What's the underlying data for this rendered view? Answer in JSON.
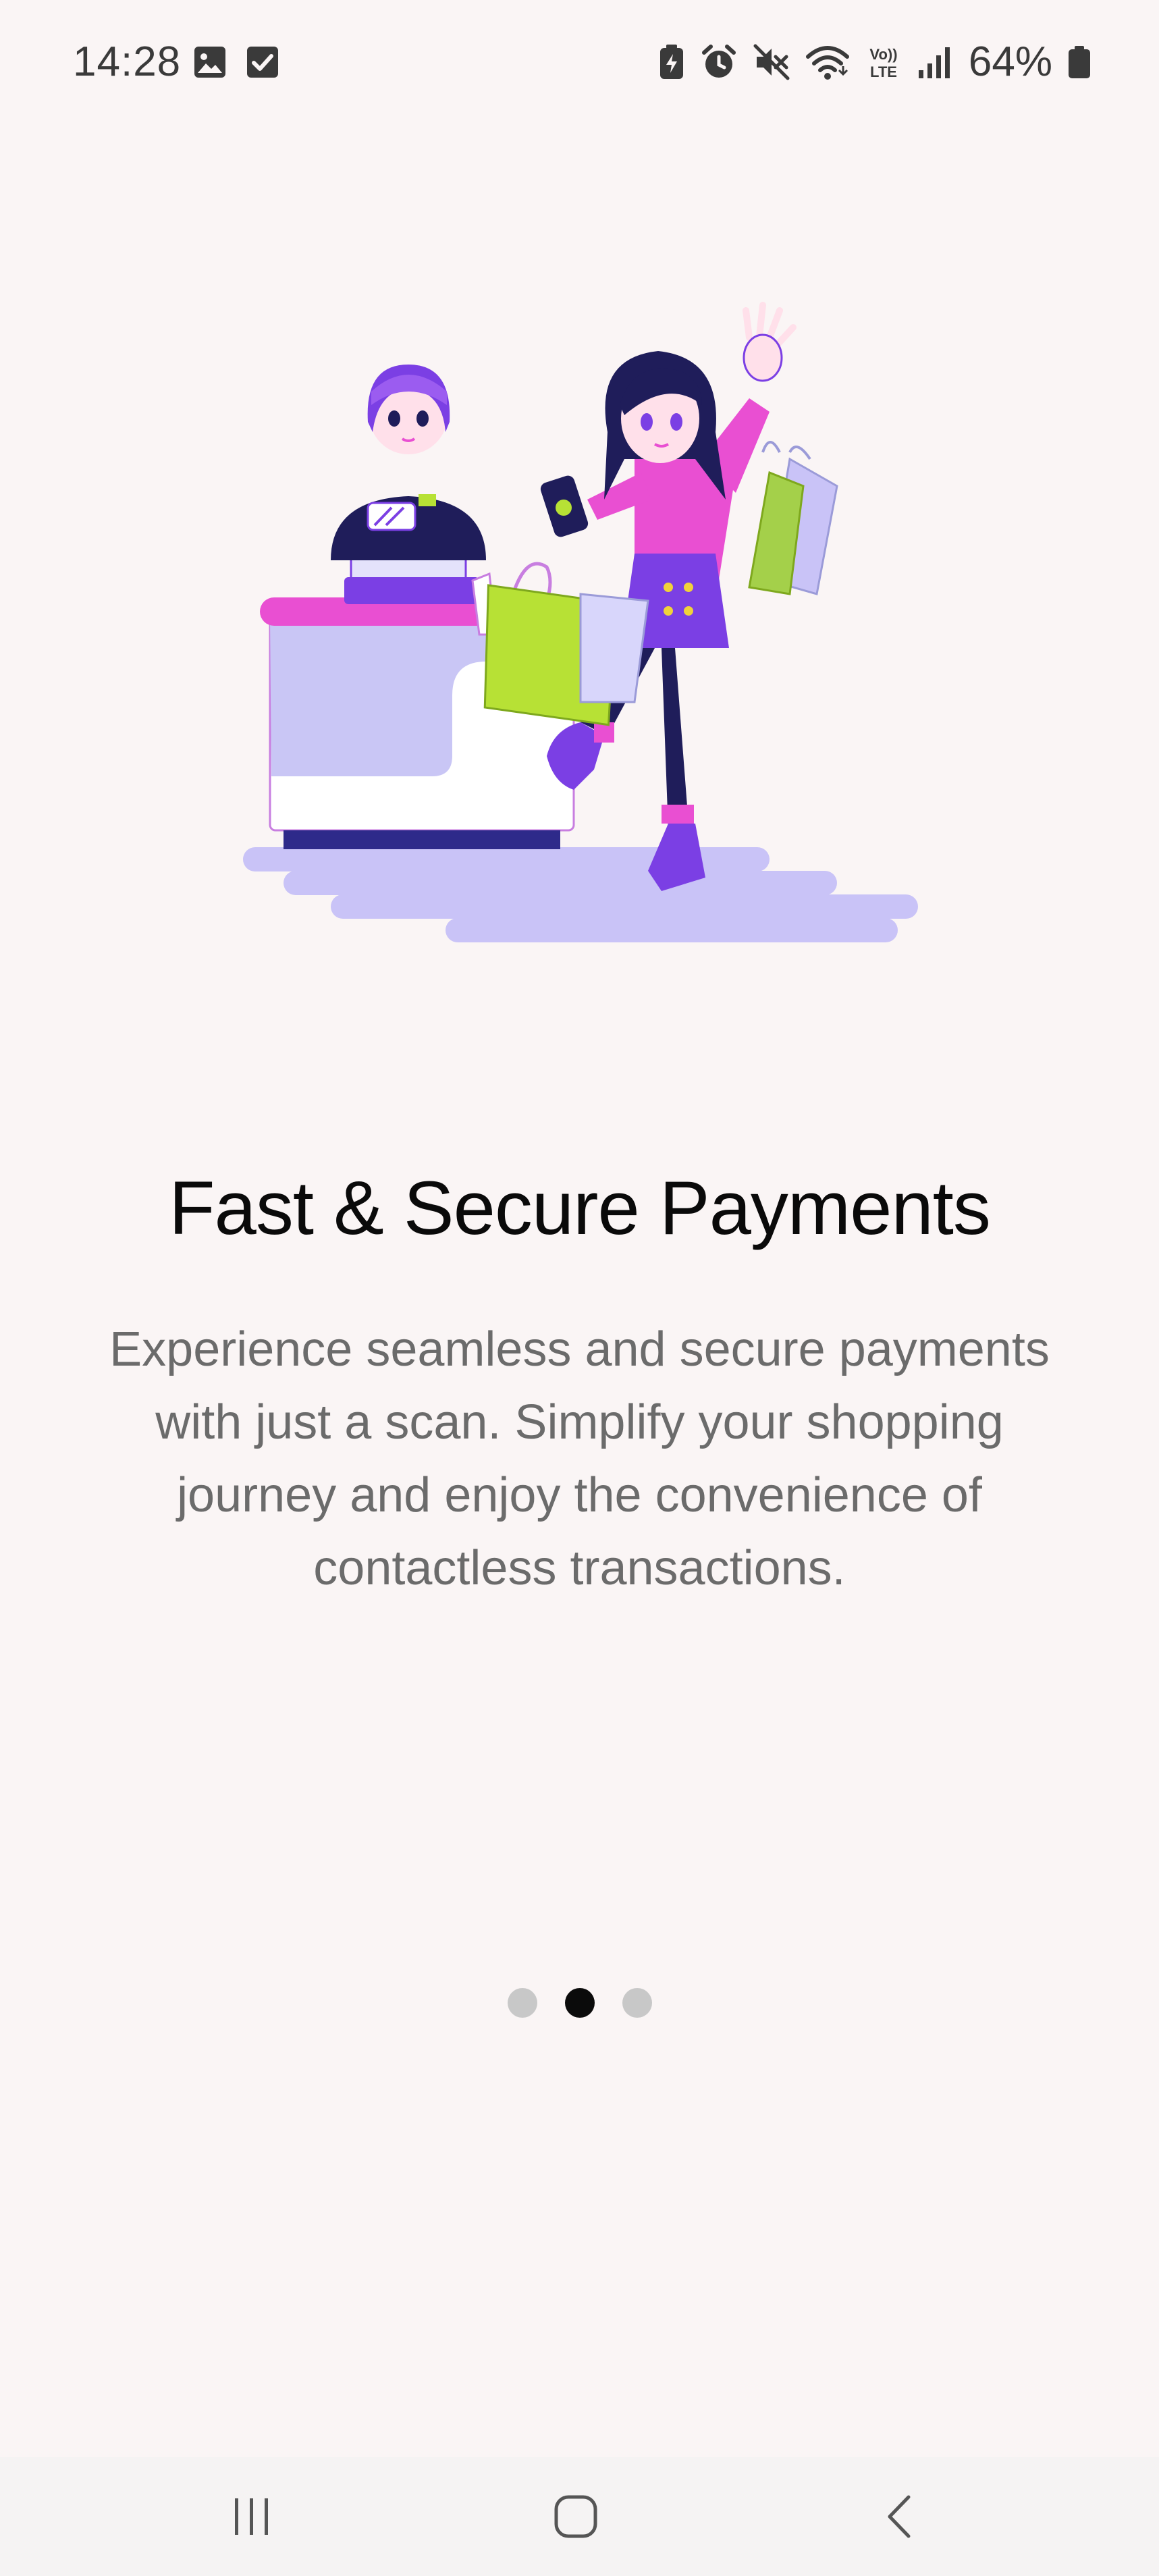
{
  "status_bar": {
    "time": "14:28",
    "battery_percent": "64%",
    "left_icons": [
      "image-icon",
      "checkbox-icon"
    ],
    "right_icons": [
      "battery-saver-icon",
      "alarm-icon",
      "mute-icon",
      "wifi-icon",
      "volte-icon",
      "signal-icon",
      "battery-icon"
    ],
    "volte_label_top": "Vo))",
    "volte_label_bottom": "LTE"
  },
  "onboarding": {
    "title": "Fast & Secure Payments",
    "description": "Experience seamless and secure payments with just a scan. Simplify your shopping journey and enjoy the convenience of contactless transactions.",
    "page_count": 3,
    "active_page": 2
  },
  "nav_bar": {
    "buttons": [
      "recent-apps",
      "home",
      "back"
    ]
  },
  "colors": {
    "background": "#faf5f5",
    "title": "#0a0a0a",
    "description": "#6b6b6b",
    "dot_active": "#0b0b0b",
    "dot_inactive": "#c8c8c8",
    "accent_pink": "#e94fd2",
    "accent_purple": "#7b3fe4",
    "accent_lime": "#b7e135",
    "accent_lavender": "#c9c3f7"
  }
}
